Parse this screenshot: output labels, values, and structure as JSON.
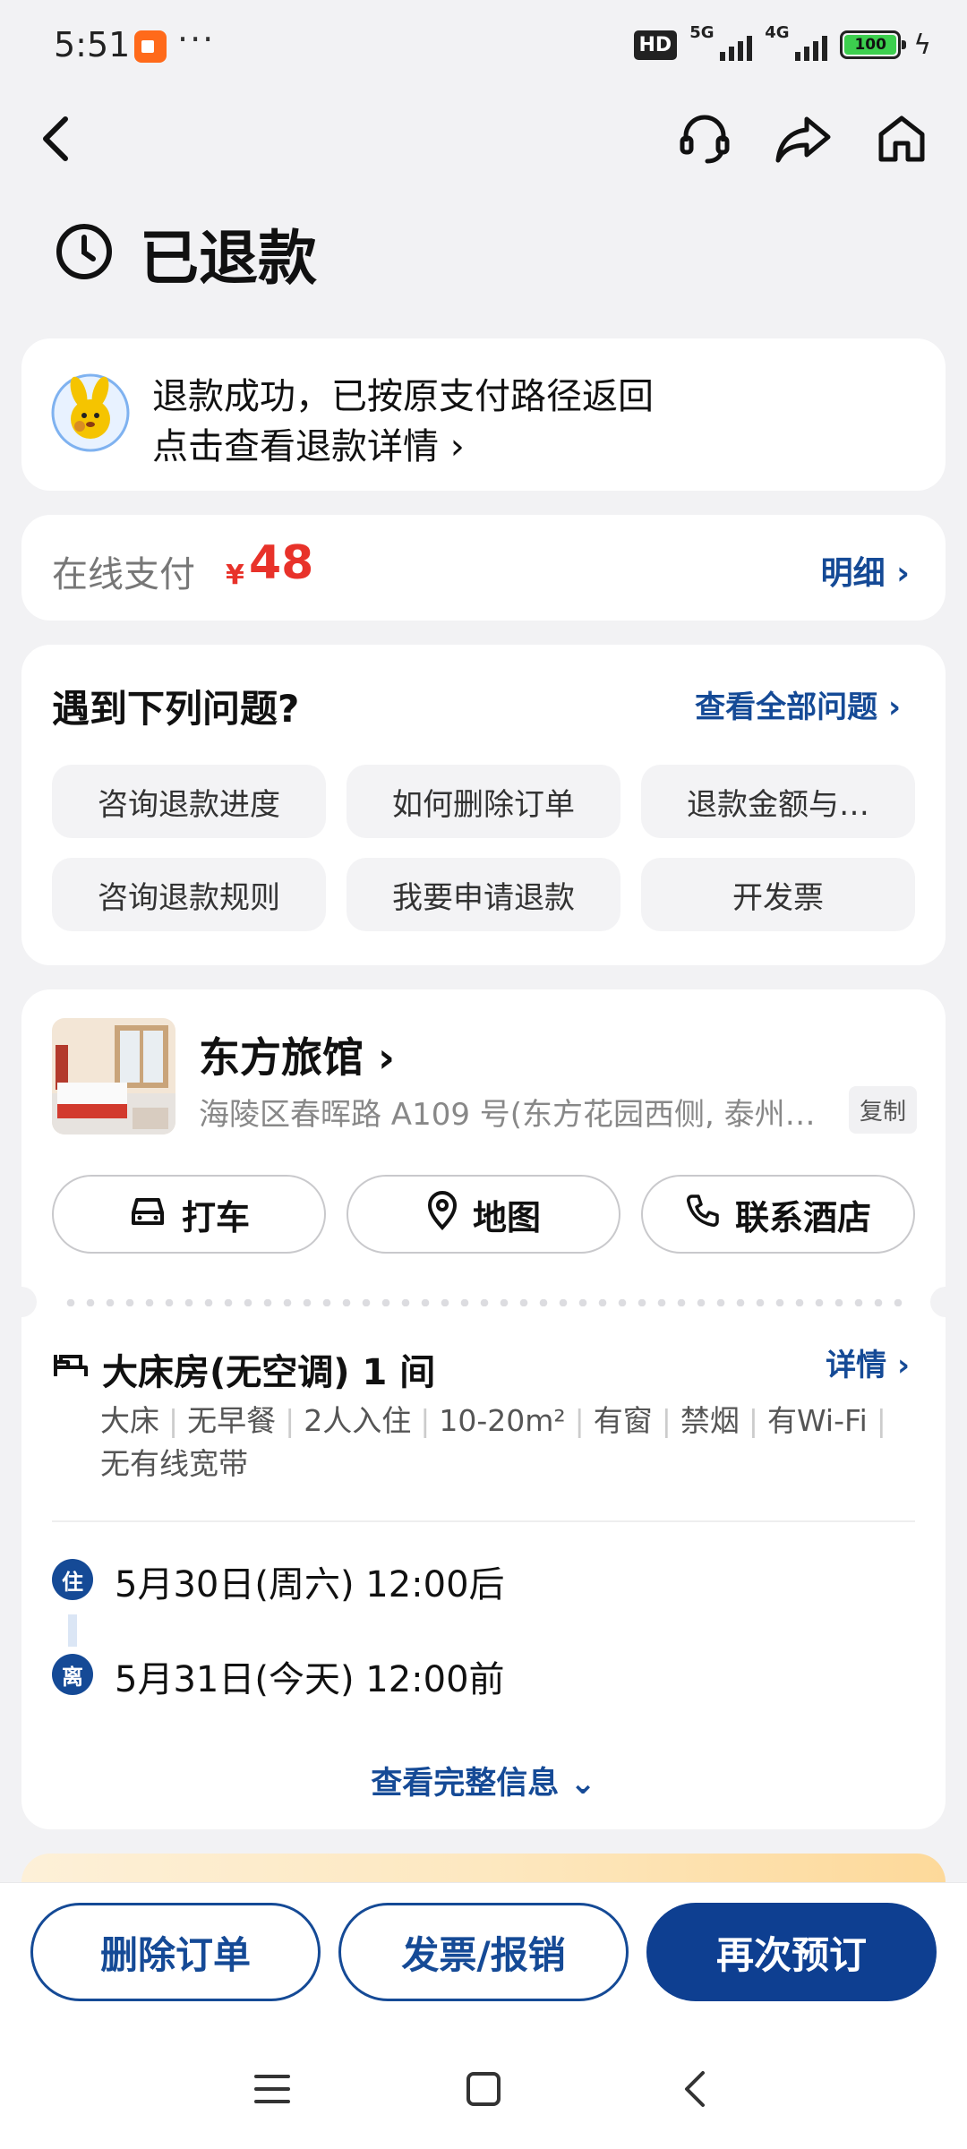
{
  "status_bar": {
    "time": "5:51",
    "more": "···",
    "hd": "HD",
    "net1": "5G",
    "net2": "4G",
    "battery": "100"
  },
  "page": {
    "title": "已退款"
  },
  "refund": {
    "line1": "退款成功，已按原支付路径返回",
    "line2": "点击查看退款详情 ›"
  },
  "payment": {
    "label": "在线支付",
    "currency": "¥",
    "amount": "48",
    "detail": "明细 ›"
  },
  "questions": {
    "title": "遇到下列问题?",
    "view_all": "查看全部问题 ›",
    "chips": [
      "咨询退款进度",
      "如何删除订单",
      "退款金额与…",
      "咨询退款规则",
      "我要申请退款",
      "开发票"
    ]
  },
  "hotel": {
    "name": "东方旅馆 ›",
    "address": "海陵区春晖路 A109 号(东方花园西侧, 泰州…",
    "copy": "复制",
    "actions": {
      "taxi": "打车",
      "map": "地图",
      "contact": "联系酒店"
    }
  },
  "room": {
    "title": "大床房(无空调) 1 间",
    "detail": "详情 ›",
    "tags": [
      "大床",
      "无早餐",
      "2人入住",
      "10-20m²",
      "有窗",
      "禁烟",
      "有Wi-Fi",
      "无有线宽带"
    ]
  },
  "stay": {
    "checkin_badge": "住",
    "checkin": "5月30日(周六) 12:00后",
    "checkout_badge": "离",
    "checkout": "5月31日(今天) 12:00前",
    "more": "查看完整信息 ⌄"
  },
  "bottom": {
    "delete": "删除订单",
    "invoice": "发票/报销",
    "rebook": "再次预订"
  },
  "colors": {
    "brand": "#154a96",
    "price": "#e8322a",
    "background": "#f2f2f4"
  },
  "icons": [
    "back-icon",
    "customer-service-icon",
    "share-icon",
    "home-icon",
    "clock-icon",
    "car-icon",
    "location-pin-icon",
    "phone-icon",
    "bed-icon",
    "menu-icon",
    "square-icon",
    "chevron-left-icon"
  ]
}
